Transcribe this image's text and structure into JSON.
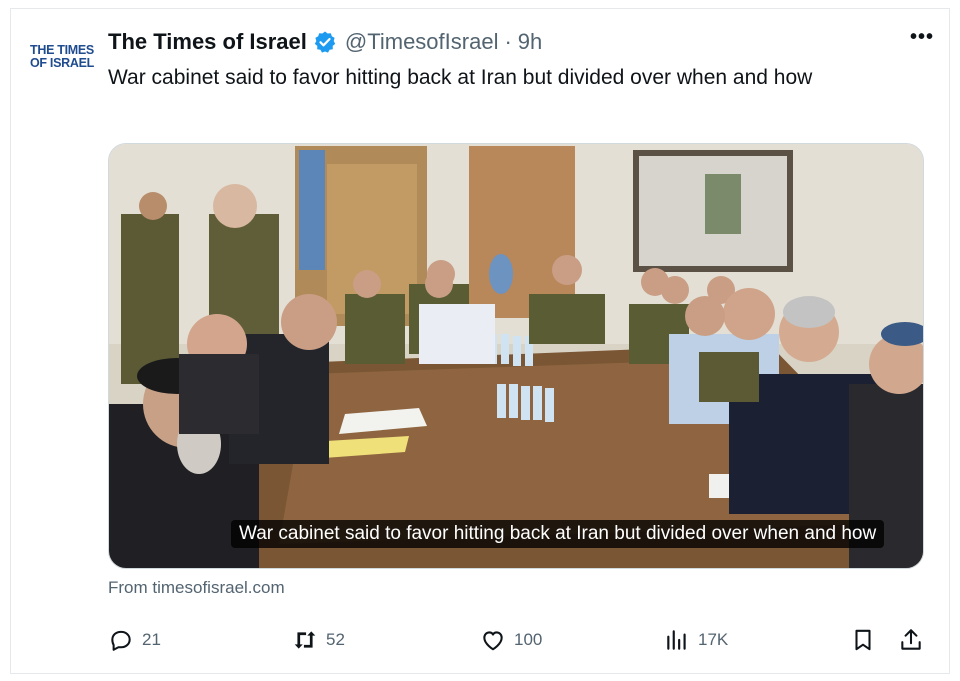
{
  "account": {
    "logo_line1": "THE TIMES",
    "logo_line2": "OF ISRAEL",
    "name": "The Times of Israel",
    "handle": "@TimesofIsrael",
    "separator": "·",
    "time": "9h",
    "verified_color": "#1d9bf0"
  },
  "more_label": "•••",
  "tweet": {
    "text": "War cabinet said to favor hitting back at Iran but divided over when and how"
  },
  "media": {
    "caption": "War cabinet said to favor hitting back at Iran but divided over when and how"
  },
  "source": "From timesofisrael.com",
  "actions": {
    "reply": {
      "icon": "reply-icon",
      "count": "21"
    },
    "retweet": {
      "icon": "retweet-icon",
      "count": "52"
    },
    "like": {
      "icon": "heart-icon",
      "count": "100"
    },
    "views": {
      "icon": "views-icon",
      "count": "17K"
    },
    "bookmark": {
      "icon": "bookmark-icon"
    },
    "share": {
      "icon": "share-icon"
    }
  },
  "colors": {
    "text": "#0f1419",
    "muted": "#536471",
    "brand": "#1f4b8f"
  }
}
